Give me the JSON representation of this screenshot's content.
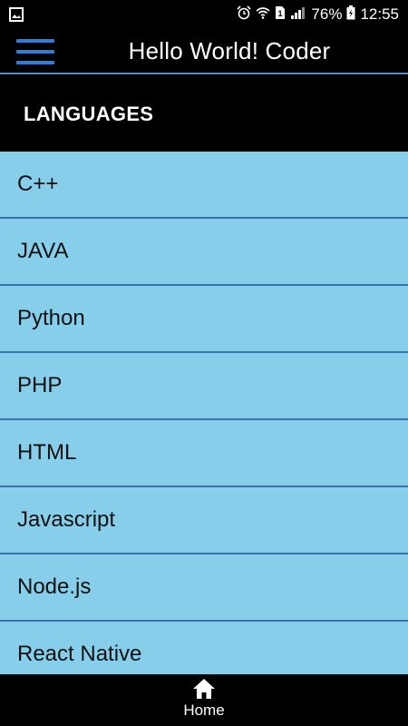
{
  "status_bar": {
    "left_icon": "image-notification-icon",
    "icons": [
      "alarm-icon",
      "wifi-icon",
      "sim-card-icon",
      "signal-icon"
    ],
    "battery_percent": "76%",
    "battery_icon": "battery-charging-icon",
    "time": "12:55"
  },
  "app_bar": {
    "title": "Hello World! Coder",
    "menu_icon": "hamburger-menu-icon",
    "accent_color": "#2f7dd6"
  },
  "section": {
    "title": "LANGUAGES"
  },
  "languages": [
    "C++",
    "JAVA",
    "Python",
    "PHP",
    "HTML",
    "Javascript",
    "Node.js",
    "React Native"
  ],
  "list_style": {
    "background": "#87ceeb",
    "divider": "#3a70ad"
  },
  "bottom_nav": {
    "home_label": "Home",
    "home_icon": "home-icon"
  }
}
